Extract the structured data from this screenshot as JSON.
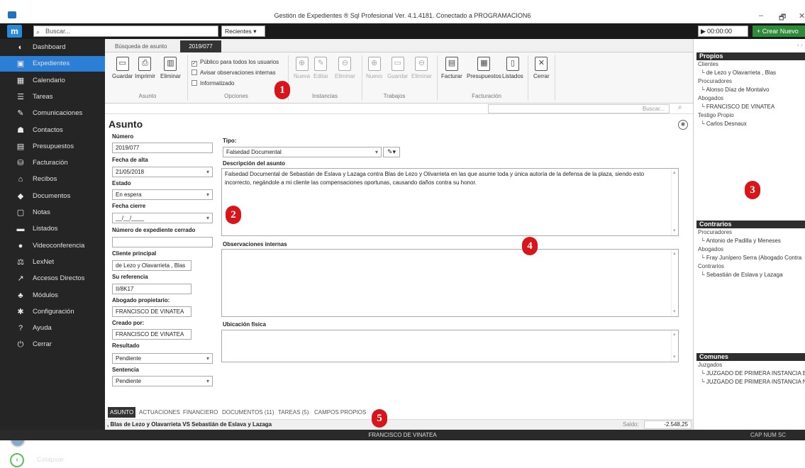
{
  "window": {
    "title": "Gestión de Expedientes ® Sql Profesional Ver. 4.1.4181. Conectado a PROGRAMACION6",
    "controls": [
      "–",
      "🗗",
      "✕"
    ]
  },
  "topbar": {
    "search_placeholder": "Buscar...",
    "recent_label": "Recientes",
    "timer": "00:00:00",
    "create_label": "+ Crear Nuevo"
  },
  "sidebar": {
    "items": [
      {
        "label": "Dashboard",
        "icon": "dashboard-icon",
        "glyph": "◐"
      },
      {
        "label": "Expedientes",
        "icon": "briefcase-icon",
        "glyph": "▣"
      },
      {
        "label": "Calendario",
        "icon": "calendar-icon",
        "glyph": "▦"
      },
      {
        "label": "Tareas",
        "icon": "tasks-icon",
        "glyph": "☰"
      },
      {
        "label": "Comunicaciones",
        "icon": "communications-icon",
        "glyph": "✎"
      },
      {
        "label": "Contactos",
        "icon": "contacts-icon",
        "glyph": "☗"
      },
      {
        "label": "Presupuestos",
        "icon": "budget-icon",
        "glyph": "▤"
      },
      {
        "label": "Facturación",
        "icon": "billing-icon",
        "glyph": "⛁"
      },
      {
        "label": "Recibos",
        "icon": "receipts-icon",
        "glyph": "⌂"
      },
      {
        "label": "Documentos",
        "icon": "documents-icon",
        "glyph": "◆"
      },
      {
        "label": "Notas",
        "icon": "notes-icon",
        "glyph": "▢"
      },
      {
        "label": "Listados",
        "icon": "list-icon",
        "glyph": "▬"
      },
      {
        "label": "Videoconferencia",
        "icon": "videoconference-icon",
        "glyph": "●"
      },
      {
        "label": "LexNet",
        "icon": "lexnet-icon",
        "glyph": "⚖"
      },
      {
        "label": "Accesos Directos",
        "icon": "shortcuts-icon",
        "glyph": "↗"
      },
      {
        "label": "Módulos",
        "icon": "modules-icon",
        "glyph": "♣"
      },
      {
        "label": "Configuración",
        "icon": "settings-icon",
        "glyph": "✱"
      },
      {
        "label": "Ayuda",
        "icon": "help-icon",
        "glyph": "?"
      },
      {
        "label": "Cerrar",
        "icon": "power-icon",
        "glyph": "⏻"
      }
    ],
    "active_index": 1,
    "user": "FRANCISCO DE VINATEA",
    "collapse_label": "Colapsar"
  },
  "tabs": {
    "search_tab": "Búsqueda de asunto",
    "active_tab": "2019/077"
  },
  "ribbon": {
    "asunto": {
      "group": "Asunto",
      "buttons": [
        "Guardar",
        "Imprimir",
        "Eliminar"
      ]
    },
    "opciones": {
      "group": "Opciones",
      "checks": [
        {
          "label": "Público para todos los usuarios",
          "checked": true
        },
        {
          "label": "Avisar observaciones internas",
          "checked": false
        },
        {
          "label": "Informatizado",
          "checked": false
        }
      ]
    },
    "instancias": {
      "group": "Instancias",
      "buttons": [
        "Nueva",
        "Editar",
        "Eliminar"
      ]
    },
    "trabajos": {
      "group": "Trabajos",
      "buttons": [
        "Nuevo",
        "Guardar",
        "Eliminar"
      ]
    },
    "facturacion": {
      "group": "Facturación",
      "buttons": [
        "Facturar",
        "Presupuestos",
        "Listados"
      ]
    },
    "cerrar": {
      "button": "Cerrar"
    }
  },
  "search_bar": {
    "placeholder": "Buscar..."
  },
  "form": {
    "title": "Asunto",
    "numero": {
      "label": "Número",
      "value": "2019/077"
    },
    "fecha_alta": {
      "label": "Fecha de alta",
      "value": "21/05/2018"
    },
    "estado": {
      "label": "Estado",
      "value": "En espera"
    },
    "fecha_cierre": {
      "label": "Fecha cierre",
      "value": "__/__/____"
    },
    "num_exp_cerrado": {
      "label": "Número de expediente cerrado",
      "value": ""
    },
    "cliente_principal": {
      "label": "Cliente principal",
      "value": "de Lezo y Olavarrieta , Blas"
    },
    "su_referencia": {
      "label": "Su referencia",
      "value": "II/8K17"
    },
    "abogado_propietario": {
      "label": "Abogado propietario:",
      "value": "FRANCISCO DE VINATEA"
    },
    "creado_por": {
      "label": "Creado por:",
      "value": "FRANCISCO DE VINATEA"
    },
    "resultado": {
      "label": "Resultado",
      "value": "Pendiente"
    },
    "sentencia": {
      "label": "Sentencia",
      "value": "Pendiente"
    },
    "tipo": {
      "label": "Tipo:",
      "value": "Falsedad Documental"
    },
    "descripcion": {
      "label": "Descripción del asunto",
      "value": "Falsedad Documental de Sebastián de Eslava y Lazaga contra Blas de Lezo y Olivarrieta en las que asume toda y única autoría de la defensa de la plaza, siendo esto incorrecto, negándole a mi cliente las compensaciones oportunas, causando daños contra su honor."
    },
    "observaciones": {
      "label": "Observaciones internas",
      "value": ""
    },
    "ubicacion": {
      "label": "Ubicación física",
      "value": ""
    }
  },
  "bottom_tabs": [
    "ASUNTO",
    "ACTUACIONES",
    "FINANCIERO",
    "DOCUMENTOS (11)",
    "TAREAS (5)",
    "CAMPOS PROPIOS"
  ],
  "status": {
    "case_title": ", Blas de Lezo y Olavarrieta VS Sebastián de Eslava y Lazaga",
    "saldo_label": "Saldo:",
    "saldo_value": "-2.548,25"
  },
  "bottom_bar": {
    "user": "FRANCISCO DE VINATEA",
    "indicators": "CAP   NUM   SC"
  },
  "right_panel": {
    "propios": {
      "title": "Propios",
      "groups": [
        {
          "category": "Clientes",
          "items": [
            "de Lezo y Olavarrieta , Blas"
          ]
        },
        {
          "category": "Procuradores",
          "items": [
            "Alonso Díaz de Montalvo"
          ]
        },
        {
          "category": "Abogados",
          "items": [
            "FRANCISCO DE VINATEA"
          ]
        },
        {
          "category": "Testigo Propio",
          "items": [
            "Carlos Desnaux"
          ]
        }
      ]
    },
    "contrarios": {
      "title": "Contrarios",
      "groups": [
        {
          "category": "Procuradores",
          "items": [
            "Antonio de Padilla y Meneses"
          ]
        },
        {
          "category": "Abogados",
          "items": [
            "Fray Junípero Serra (Abogado Contra"
          ]
        },
        {
          "category": "Contrarios",
          "items": [
            "Sebastián de Eslava y Lazaga"
          ]
        }
      ]
    },
    "comunes": {
      "title": "Comunes",
      "groups": [
        {
          "category": "Juzgados",
          "items": [
            "JUZGADO DE PRIMERA INSTANCIA E I",
            "JUZGADO DE PRIMERA INSTANCIA NU"
          ]
        }
      ]
    }
  },
  "annotations": [
    "1",
    "2",
    "3",
    "4",
    "5"
  ],
  "colors": {
    "accent": "#2b7fd6",
    "sidebar": "#252525",
    "badge": "#d8151a",
    "create": "#2e8b3a"
  }
}
